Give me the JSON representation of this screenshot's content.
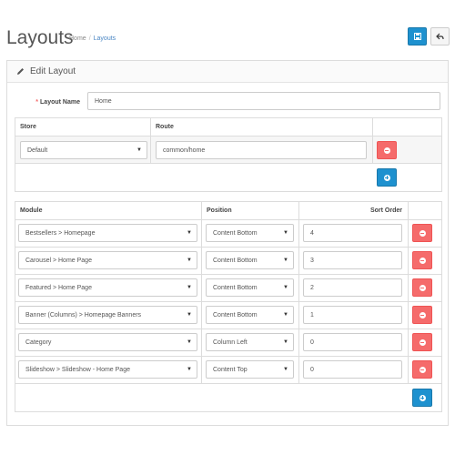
{
  "header": {
    "title": "Layouts",
    "breadcrumb": [
      {
        "label": "Home"
      },
      {
        "label": "Layouts"
      }
    ],
    "save_icon": "save-icon",
    "back_icon": "reply-icon"
  },
  "panel": {
    "title": "Edit Layout",
    "title_icon": "pencil-icon"
  },
  "form": {
    "layout_name_label": "Layout Name",
    "required_mark": "*",
    "layout_name_value": "Home"
  },
  "routes_table": {
    "headers": {
      "store": "Store",
      "route": "Route"
    },
    "rows": [
      {
        "store": "Default",
        "route": "common/home"
      }
    ]
  },
  "modules_table": {
    "headers": {
      "module": "Module",
      "position": "Position",
      "sort_order": "Sort Order"
    },
    "rows": [
      {
        "module": "Bestsellers > Homepage",
        "position": "Content Bottom",
        "sort_order": "4"
      },
      {
        "module": "Carousel > Home Page",
        "position": "Content Bottom",
        "sort_order": "3"
      },
      {
        "module": "Featured > Home Page",
        "position": "Content Bottom",
        "sort_order": "2"
      },
      {
        "module": "Banner (Columns) > Homepage Banners",
        "position": "Content Bottom",
        "sort_order": "1"
      },
      {
        "module": "Category",
        "position": "Column Left",
        "sort_order": "0"
      },
      {
        "module": "Slideshow > Slideshow - Home Page",
        "position": "Content Top",
        "sort_order": "0"
      }
    ]
  },
  "colors": {
    "primary": "#1e91cf",
    "danger": "#f56b6b",
    "breadcrumb_active": "#4b87c4"
  }
}
